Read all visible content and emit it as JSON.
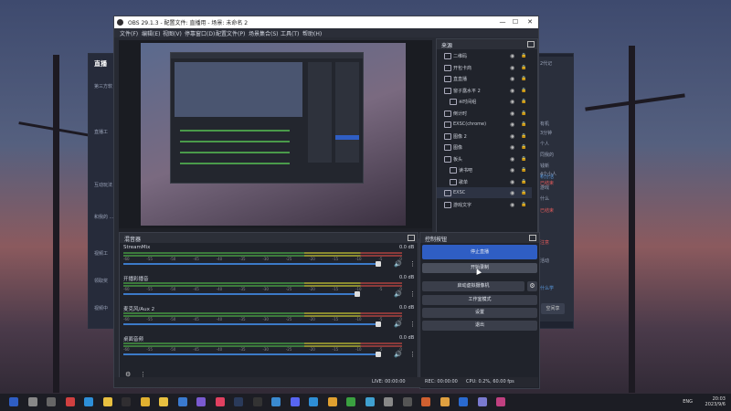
{
  "window": {
    "title": "OBS 29.1.3 - 配置文件: 直播用 - 场景: 未命名 2"
  },
  "menu": [
    "文件(F)",
    "编辑(E)",
    "视图(V)",
    "停靠窗口(D)",
    "配置文件(P)",
    "场景集合(S)",
    "工具(T)",
    "帮助(H)"
  ],
  "background_app": {
    "logo": "直播",
    "left_items": [
      "第三方软",
      "直播工",
      "互动玩法",
      "和我的 ...",
      "视频工",
      "领取奖",
      "视频中"
    ],
    "right_items": [
      "2代记",
      "有机",
      "3分钟",
      "个人",
      "同我的",
      "钱新",
      "积分活",
      "游戏",
      "什么",
      "4个小人",
      "已结束",
      "已结束",
      "注意",
      "活动",
      "什么学"
    ],
    "button": "空间享"
  },
  "scenes": {
    "header": "来源",
    "items": [
      {
        "name": "二维码",
        "folder": false
      },
      {
        "name": "开包卡商",
        "folder": false
      },
      {
        "name": "直直播",
        "folder": false
      },
      {
        "name": "窗子露水平 2",
        "folder": false
      },
      {
        "name": "※时间组",
        "folder": true
      },
      {
        "name": "倒计时",
        "folder": false
      },
      {
        "name": "EXSC(chrome)",
        "folder": false
      },
      {
        "name": "图像 2",
        "folder": false
      },
      {
        "name": "图像",
        "folder": false
      },
      {
        "name": "板头",
        "folder": false
      },
      {
        "name": "读书吧",
        "folder": true
      },
      {
        "name": "歌单",
        "folder": true
      },
      {
        "name": "EXSC",
        "folder": false
      },
      {
        "name": "游戏文字",
        "folder": false
      }
    ],
    "selected_index": 12
  },
  "mixer": {
    "header": "混音器",
    "tracks": [
      {
        "name": "StreamMix",
        "db": "0.0 dB",
        "level": 0.96
      },
      {
        "name": "开播彩播音",
        "db": "0.0 dB",
        "level": 0.88
      },
      {
        "name": "麦克风/Aux 2",
        "db": "0.0 dB",
        "level": 0.96
      },
      {
        "name": "桌面音频",
        "db": "0.0 dB",
        "level": 0.96
      }
    ],
    "ticks": [
      "-60",
      "-55",
      "-50",
      "-45",
      "-40",
      "-35",
      "-30",
      "-25",
      "-20",
      "-15",
      "-10",
      "-5",
      "0"
    ]
  },
  "controls": {
    "header": "控制按钮",
    "stop_stream": "停止直播",
    "start_record": "开始录制",
    "virtual_cam": "启动虚拟摄像机",
    "studio": "工作室模式",
    "settings": "设置",
    "exit": "退出"
  },
  "status": {
    "live": "LIVE: 00:00:00",
    "rec": "REC: 00:00:00",
    "cpu": "CPU: 0.2%, 60.00 fps"
  },
  "taskbar": {
    "icons": [
      "windows-icon",
      "search-icon",
      "widgets-icon",
      "chat-icon",
      "store-icon",
      "explorer-icon",
      "obs-icon",
      "chrome-icon",
      "folder-icon",
      "mail-icon",
      "photos-icon",
      "music-icon",
      "steam-icon",
      "terminal-icon",
      "calendar-icon",
      "discord-icon",
      "edge-icon",
      "notes-icon",
      "xbox-icon",
      "camera-icon",
      "settings-icon",
      "calc-icon",
      "game-icon",
      "paint-icon",
      "word-icon",
      "tool-icon",
      "app-icon"
    ],
    "lang": "ENG",
    "time": "20:03",
    "date": "2023/9/6",
    "accent": "#2f5ec4"
  }
}
